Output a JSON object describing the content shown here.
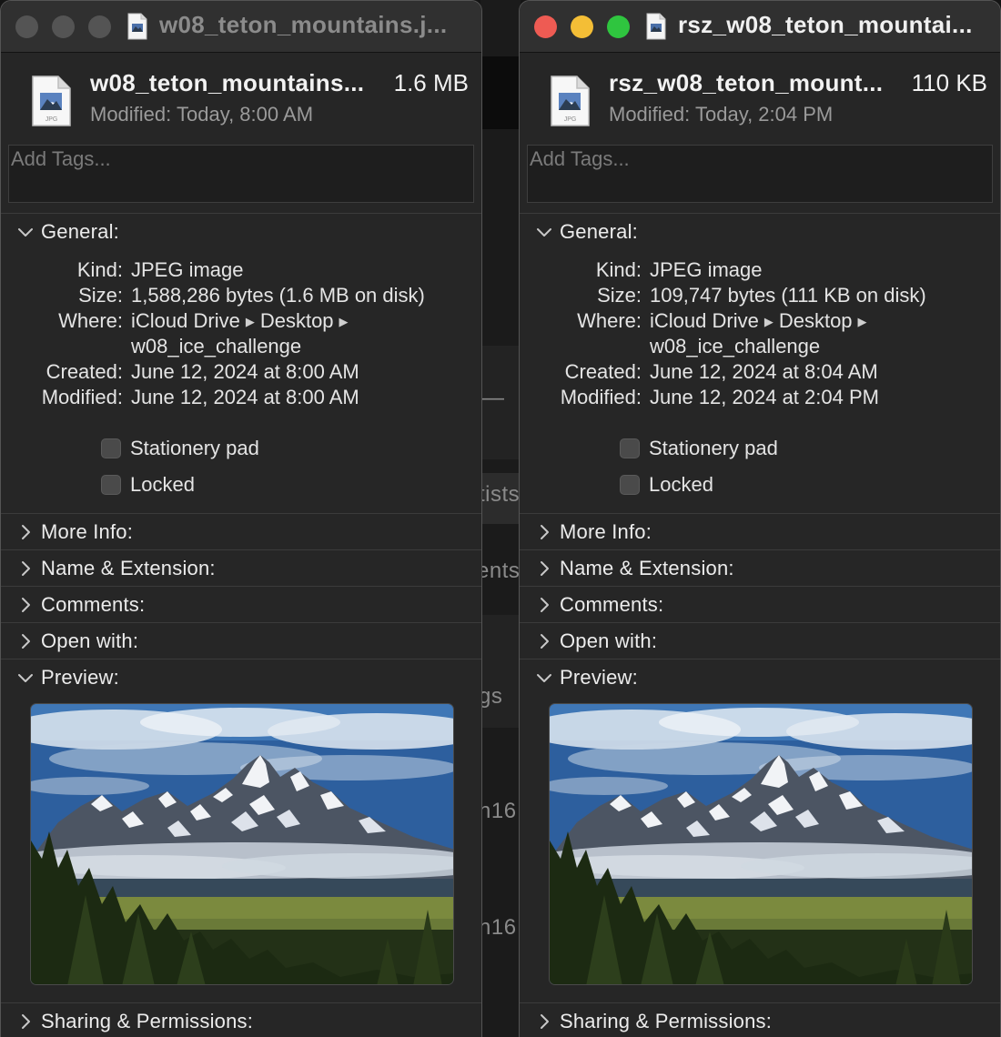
{
  "background": {
    "fragments": [
      "—",
      "tists",
      "ents",
      "gs",
      "n16",
      "n16"
    ]
  },
  "windows": [
    {
      "id": "left",
      "active": false,
      "title": "w08_teton_mountains.j...",
      "file_name": "w08_teton_mountains...",
      "file_size": "1.6 MB",
      "modified_label": "Modified:",
      "modified_value": "Today, 8:00 AM",
      "icon_label": "JPG",
      "tags_placeholder": "Add Tags...",
      "sections": {
        "general": "General:",
        "more_info": "More Info:",
        "name_extension": "Name & Extension:",
        "comments": "Comments:",
        "open_with": "Open with:",
        "preview": "Preview:",
        "sharing": "Sharing & Permissions:"
      },
      "general": {
        "kind_key": "Kind:",
        "kind": "JPEG image",
        "size_key": "Size:",
        "size": "1,588,286 bytes (1.6 MB on disk)",
        "where_key": "Where:",
        "where_1": "iCloud Drive",
        "where_2": "Desktop",
        "where_3": "w08_ice_challenge",
        "created_key": "Created:",
        "created": "June 12, 2024 at 8:00 AM",
        "modified_key": "Modified:",
        "modified": "June 12, 2024 at 8:00 AM"
      },
      "stationery_pad": "Stationery pad",
      "locked": "Locked",
      "stationery_checked": false,
      "locked_checked": false
    },
    {
      "id": "right",
      "active": true,
      "title": "rsz_w08_teton_mountai...",
      "file_name": "rsz_w08_teton_mount...",
      "file_size": "110 KB",
      "modified_label": "Modified:",
      "modified_value": "Today, 2:04 PM",
      "icon_label": "JPG",
      "tags_placeholder": "Add Tags...",
      "sections": {
        "general": "General:",
        "more_info": "More Info:",
        "name_extension": "Name & Extension:",
        "comments": "Comments:",
        "open_with": "Open with:",
        "preview": "Preview:",
        "sharing": "Sharing & Permissions:"
      },
      "general": {
        "kind_key": "Kind:",
        "kind": "JPEG image",
        "size_key": "Size:",
        "size": "109,747 bytes (111 KB on disk)",
        "where_key": "Where:",
        "where_1": "iCloud Drive",
        "where_2": "Desktop",
        "where_3": "w08_ice_challenge",
        "created_key": "Created:",
        "created": "June 12, 2024 at 8:04 AM",
        "modified_key": "Modified:",
        "modified": "June 12, 2024 at 2:04 PM"
      },
      "stationery_pad": "Stationery pad",
      "locked": "Locked",
      "stationery_checked": false,
      "locked_checked": false
    }
  ],
  "colors": {
    "close": "#ee5b53",
    "minimize": "#f4be36",
    "zoom": "#2fc53f",
    "inactive_light": "#545454",
    "panel": "#262626"
  },
  "icons": [
    "jpg-file-icon",
    "chevron-down-icon",
    "chevron-right-icon",
    "path-arrow-icon"
  ]
}
